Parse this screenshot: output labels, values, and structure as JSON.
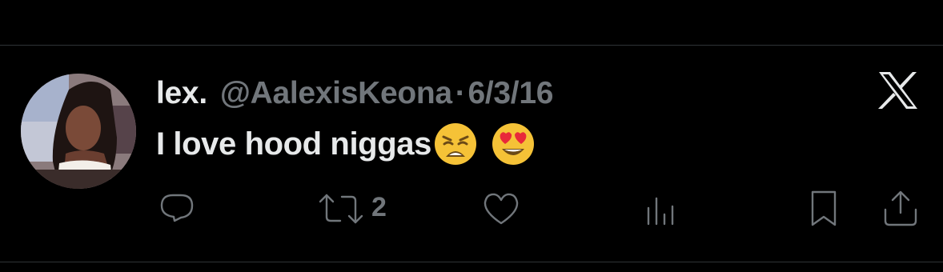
{
  "tweet": {
    "author_name": "lex.",
    "handle": "@AalexisKeona",
    "separator": "·",
    "date": "6/3/16",
    "text": "I love hood niggas",
    "emojis": [
      "weary-face",
      "smiling-face-with-heart-eyes"
    ]
  },
  "actions": {
    "reply": {
      "icon": "reply-icon"
    },
    "repost": {
      "icon": "repost-icon",
      "count": "2"
    },
    "like": {
      "icon": "like-icon"
    },
    "views": {
      "icon": "views-icon"
    },
    "bookmark": {
      "icon": "bookmark-icon"
    },
    "share": {
      "icon": "share-icon"
    }
  },
  "brand": {
    "logo": "x-logo",
    "color": "#e7e9ea"
  },
  "colors": {
    "background": "#000000",
    "text": "#e7e9ea",
    "muted": "#71767b",
    "divider": "#2f3336"
  }
}
